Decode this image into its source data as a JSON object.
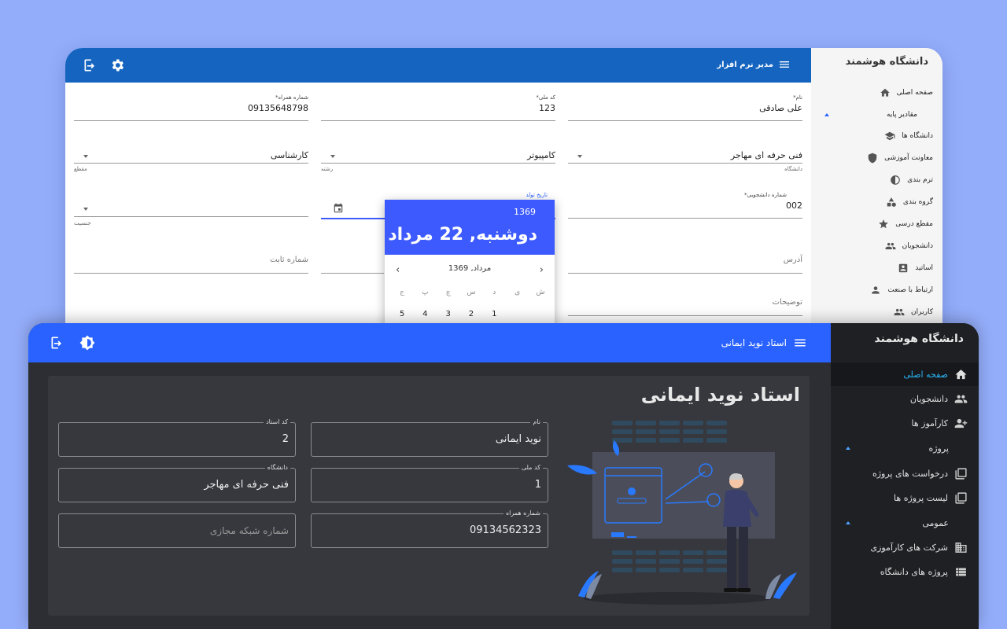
{
  "window1": {
    "brand": "دانشگاه هوشمند",
    "topbar_title": "مدیر نرم افزار",
    "sidebar": [
      {
        "label": "صفحه اصلی",
        "icon": "home-icon"
      },
      {
        "label": "مقادیر پایه",
        "icon": "",
        "expanded": true
      },
      {
        "label": "دانشگاه ها",
        "icon": "school-icon"
      },
      {
        "label": "معاونت آموزشی",
        "icon": "shield-icon"
      },
      {
        "label": "ترم بندی",
        "icon": "pie-icon"
      },
      {
        "label": "گروه بندی",
        "icon": "shapes-icon"
      },
      {
        "label": "مقطع درسی",
        "icon": "star-icon"
      },
      {
        "label": "دانشجویان",
        "icon": "people-icon"
      },
      {
        "label": "اساتید",
        "icon": "badge-icon"
      },
      {
        "label": "ارتباط با صنعت",
        "icon": "person-icon"
      },
      {
        "label": "کاربران",
        "icon": "group-icon"
      }
    ],
    "form": {
      "name": {
        "label": "نام*",
        "value": "علی صادقی"
      },
      "national_code": {
        "label": "کد ملی*",
        "value": "123"
      },
      "mobile": {
        "label": "شماره همراه*",
        "value": "09135648798"
      },
      "university": {
        "value": "فنی حرفه ای مهاجر",
        "hint": "دانشگاه"
      },
      "major": {
        "value": "کامپیوتر",
        "hint": "رشته"
      },
      "degree": {
        "value": "کارشناسی",
        "hint": "مقطع"
      },
      "student_number": {
        "label": "شماره دانشجویی*",
        "value": "002"
      },
      "birth_date": {
        "label": "تاریخ تولد"
      },
      "gender": {
        "hint": "جنسیت"
      },
      "address": {
        "placeholder": "آدرس"
      },
      "landline": {
        "placeholder": "شماره ثابت"
      },
      "description": {
        "placeholder": "توضیحات"
      }
    },
    "date_picker": {
      "year": "1369",
      "date": "دوشنبه, 22 مرداد",
      "month_year": "مرداد, 1369",
      "weekdays": [
        "ش",
        "ی",
        "د",
        "س",
        "چ",
        "پ",
        "ج"
      ],
      "first_row": [
        "",
        "",
        "1",
        "2",
        "3",
        "4",
        "5"
      ]
    }
  },
  "window2": {
    "brand": "دانشگاه هوشمند",
    "topbar_title": "استاد نوید ایمانی",
    "heading": "استاد نوید ایمانی",
    "accent": "#2962ff",
    "sidebar": [
      {
        "label": "صفحه اصلی",
        "icon": "home-icon",
        "active": true
      },
      {
        "label": "دانشجویان",
        "icon": "people-icon"
      },
      {
        "label": "کارآموز ها",
        "icon": "person-add-icon"
      },
      {
        "label": "پروژه",
        "group": true
      },
      {
        "label": "درخواست های پروژه",
        "icon": "library-icon"
      },
      {
        "label": "لیست پروژه ها",
        "icon": "library-icon"
      },
      {
        "label": "عمومی",
        "group": true
      },
      {
        "label": "شرکت های کارآموزی",
        "icon": "building-icon"
      },
      {
        "label": "پروژه های دانشگاه",
        "icon": "list-icon"
      }
    ],
    "fields": {
      "name": {
        "label": "نام",
        "value": "نوید ایمانی"
      },
      "teacher_code": {
        "label": "کد استاد",
        "value": "2"
      },
      "national_code": {
        "label": "کد ملی",
        "value": "1"
      },
      "university": {
        "label": "دانشگاه",
        "value": "فنی حرفه ای مهاجر"
      },
      "mobile": {
        "label": "شماره همراه",
        "value": "09134562323"
      },
      "social": {
        "placeholder": "شماره شبکه مجازی"
      }
    }
  }
}
